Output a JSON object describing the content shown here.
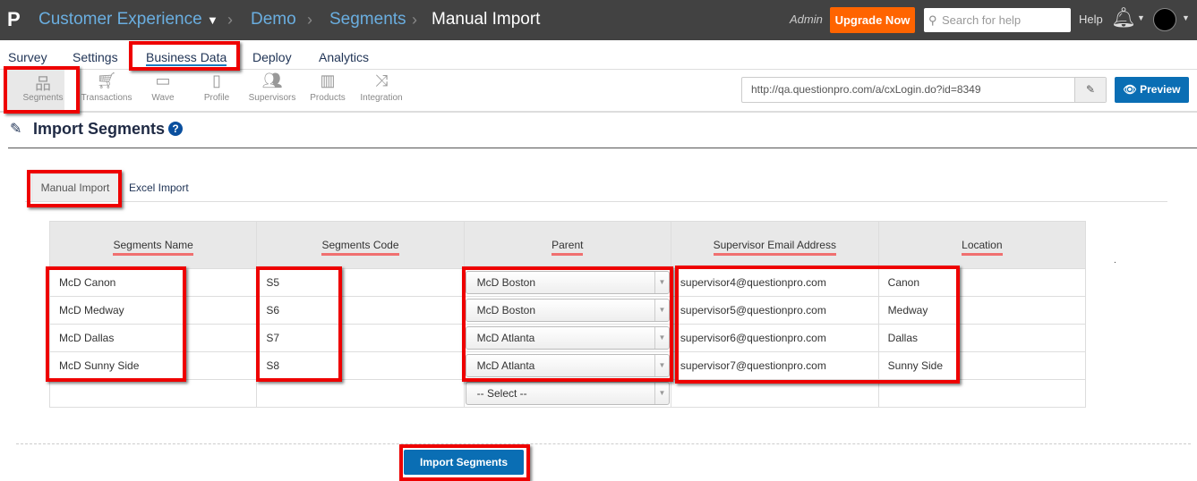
{
  "header": {
    "logo": "P",
    "product": "Customer Experience",
    "crumbs": [
      "Demo",
      "Segments"
    ],
    "current": "Manual Import",
    "role": "Admin",
    "upgrade": "Upgrade Now",
    "search_placeholder": "Search for help",
    "help": "Help"
  },
  "nav": {
    "tabs": [
      "Survey",
      "Settings",
      "Business Data",
      "Deploy",
      "Analytics"
    ],
    "active": "Business Data"
  },
  "toolbar": {
    "items": [
      "Segments",
      "Transactions",
      "Wave",
      "Profile",
      "Supervisors",
      "Products",
      "Integration"
    ],
    "url": "http://qa.questionpro.com/a/cxLogin.do?id=8349",
    "preview": "Preview"
  },
  "page": {
    "title": "Import Segments",
    "subtabs": [
      "Manual Import",
      "Excel Import"
    ]
  },
  "table": {
    "headers": [
      "Segments Name",
      "Segments Code",
      "Parent",
      "Supervisor Email Address",
      "Location"
    ],
    "rows": [
      [
        "McD Canon",
        "S5",
        "McD Boston",
        "supervisor4@questionpro.com",
        "Canon"
      ],
      [
        "McD Medway",
        "S6",
        "McD Boston",
        "supervisor5@questionpro.com",
        "Medway"
      ],
      [
        "McD Dallas",
        "S7",
        "McD Atlanta",
        "supervisor6@questionpro.com",
        "Dallas"
      ],
      [
        "McD Sunny Side",
        "S8",
        "McD Atlanta",
        "supervisor7@questionpro.com",
        "Sunny Side"
      ],
      [
        "",
        "",
        "-- Select --",
        "",
        ""
      ]
    ]
  },
  "actions": {
    "import": "Import Segments"
  },
  "colors": {
    "accent": "#0a6eb4",
    "upgrade": "#ff6400",
    "annotation": "#ee0000"
  }
}
